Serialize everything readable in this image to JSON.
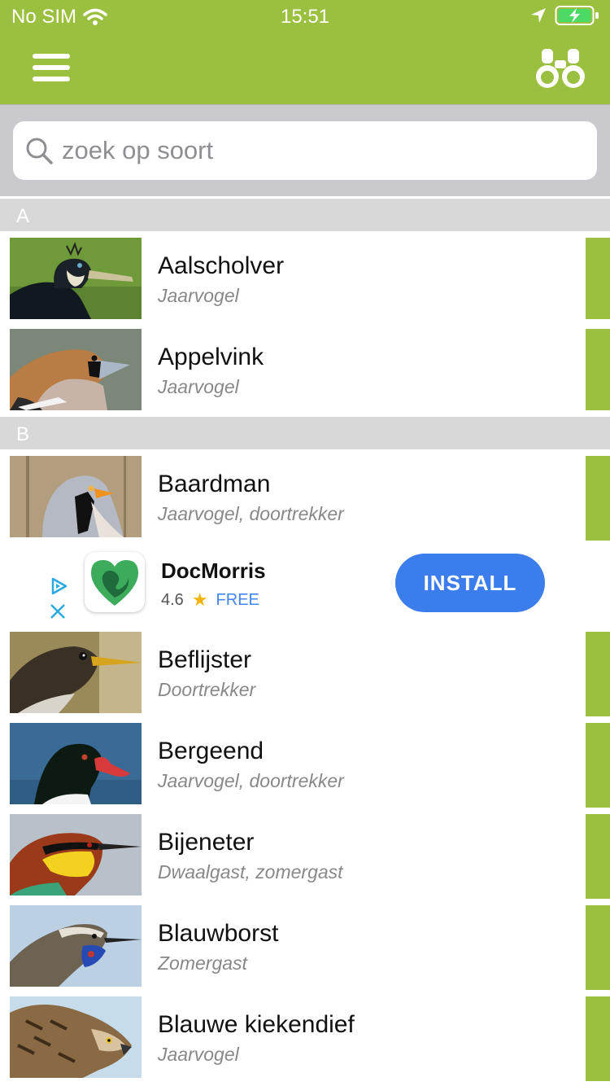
{
  "status": {
    "carrier": "No SIM",
    "time": "15:51"
  },
  "search": {
    "placeholder": "zoek op soort"
  },
  "sections": [
    {
      "letter": "A",
      "items": [
        {
          "name": "Aalscholver",
          "sub": "Jaarvogel"
        },
        {
          "name": "Appelvink",
          "sub": "Jaarvogel"
        }
      ]
    },
    {
      "letter": "B",
      "items": [
        {
          "name": "Baardman",
          "sub": "Jaarvogel, doortrekker"
        },
        {
          "name": "Beflijster",
          "sub": "Doortrekker"
        },
        {
          "name": "Bergeend",
          "sub": "Jaarvogel, doortrekker"
        },
        {
          "name": "Bijeneter",
          "sub": "Dwaalgast, zomergast"
        },
        {
          "name": "Blauwborst",
          "sub": "Zomergast"
        },
        {
          "name": "Blauwe kiekendief",
          "sub": "Jaarvogel"
        }
      ]
    }
  ],
  "ad": {
    "app_name": "DocMorris",
    "rating": "4.6",
    "price": "FREE",
    "cta": "INSTALL"
  },
  "colors": {
    "accent": "#9bbf3f",
    "section_bg": "#d8d8d8",
    "install": "#3b7ded"
  }
}
